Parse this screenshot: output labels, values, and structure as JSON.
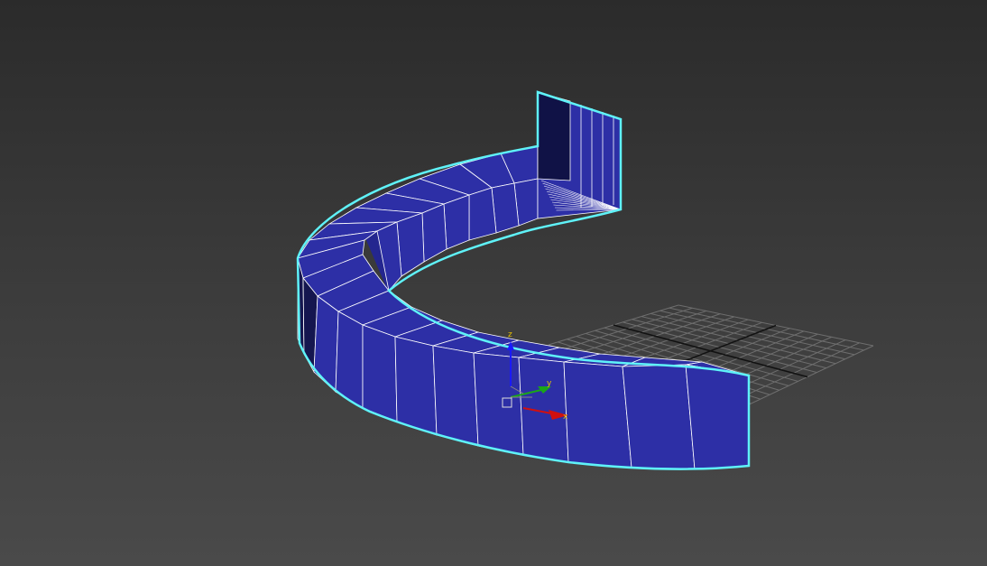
{
  "viewport": {
    "background_top": "#2b2b2b",
    "background_bottom": "#4a4a4a"
  },
  "model": {
    "face_color": "#2d2fa6",
    "edge_color": "#ffffff",
    "selection_outline_color": "#5ff2f8",
    "selected": true
  },
  "grid": {
    "line_color": "#6e6e6e",
    "axis_line_color": "#111111"
  },
  "gizmo": {
    "z_label": "z",
    "y_label": "y",
    "x_label": "x",
    "z_color": "#1a1aff",
    "y_color": "#1aa51a",
    "x_color": "#d01010",
    "label_color": "#e8c000",
    "pivot_icon": "pivot-square-icon"
  }
}
